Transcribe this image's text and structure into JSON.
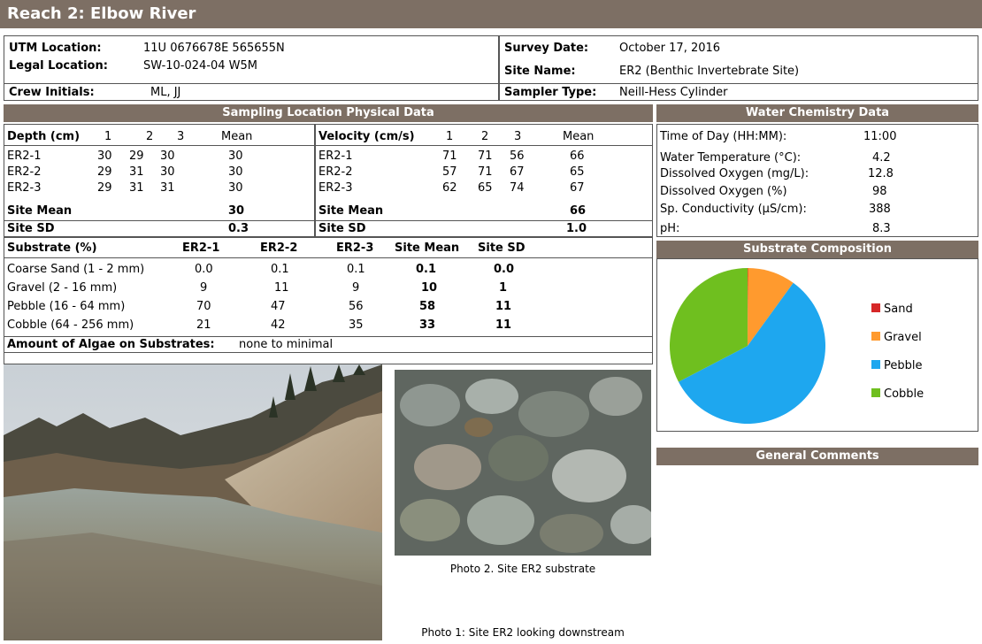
{
  "title": "Reach 2: Elbow River",
  "site": {
    "utm_label": "UTM Location:",
    "utm_value": "11U  0676678E  565655N",
    "legal_label": "Legal Location:",
    "legal_value": "SW-10-024-04 W5M",
    "crew_label": "Crew Initials:",
    "crew_value": "ML, JJ",
    "survey_label": "Survey Date:",
    "survey_value": "October 17, 2016",
    "sitename_label": "Site Name:",
    "sitename_value": "ER2  (Benthic Invertebrate Site)",
    "sampler_label": "Sampler Type:",
    "sampler_value": "Neill-Hess Cylinder"
  },
  "physical": {
    "header": "Sampling Location Physical Data",
    "depth": {
      "title": "Depth (cm)",
      "cols": [
        "1",
        "2",
        "3",
        "Mean"
      ],
      "rows": [
        {
          "name": "ER2-1",
          "v": [
            "30",
            "29",
            "30",
            "30"
          ]
        },
        {
          "name": "ER2-2",
          "v": [
            "29",
            "31",
            "30",
            "30"
          ]
        },
        {
          "name": "ER2-3",
          "v": [
            "29",
            "31",
            "31",
            "30"
          ]
        }
      ],
      "site_mean_label": "Site Mean",
      "site_mean": "30",
      "site_sd_label": "Site SD",
      "site_sd": "0.3"
    },
    "velocity": {
      "title": "Velocity (cm/s)",
      "cols": [
        "1",
        "2",
        "3",
        "Mean"
      ],
      "rows": [
        {
          "name": "ER2-1",
          "v": [
            "71",
            "71",
            "56",
            "66"
          ]
        },
        {
          "name": "ER2-2",
          "v": [
            "57",
            "71",
            "67",
            "65"
          ]
        },
        {
          "name": "ER2-3",
          "v": [
            "62",
            "65",
            "74",
            "67"
          ]
        }
      ],
      "site_mean_label": "Site Mean",
      "site_mean": "66",
      "site_sd_label": "Site SD",
      "site_sd": "1.0"
    }
  },
  "substrate": {
    "cols": [
      "Substrate (%)",
      "ER2-1",
      "ER2-2",
      "ER2-3",
      "Site Mean",
      "Site SD"
    ],
    "rows": [
      [
        "Coarse Sand (1 - 2 mm)",
        "0.0",
        "0.1",
        "0.1",
        "0.1",
        "0.0"
      ],
      [
        "Gravel (2 - 16 mm)",
        "9",
        "11",
        "9",
        "10",
        "1"
      ],
      [
        "Pebble (16 - 64 mm)",
        "70",
        "47",
        "56",
        "58",
        "11"
      ],
      [
        "Cobble (64 - 256 mm)",
        "21",
        "42",
        "35",
        "33",
        "11"
      ]
    ],
    "algae_label": "Amount of Algae on Substrates:",
    "algae_value": "none to minimal"
  },
  "water": {
    "header": "Water Chemistry Data",
    "rows": [
      {
        "label": "Time of Day (HH:MM):",
        "value": "11:00"
      },
      {
        "label": "Water Temperature (°C):",
        "value": "4.2"
      },
      {
        "label": "Dissolved Oxygen (mg/L):",
        "value": "12.8"
      },
      {
        "label": "Dissolved Oxygen (%)",
        "value": "98"
      },
      {
        "label": "Sp. Conductivity (µS/cm):",
        "value": "388"
      },
      {
        "label": "pH:",
        "value": "8.3"
      }
    ]
  },
  "composition_header": "Substrate Composition",
  "comments_header": "General Comments",
  "photo1_caption": "Photo 1: Site ER2 looking downstream",
  "photo2_caption": "Photo 2. Site ER2 substrate",
  "chart_data": {
    "type": "pie",
    "categories": [
      "Sand",
      "Gravel",
      "Pebble",
      "Cobble"
    ],
    "values": [
      0.1,
      10,
      58,
      33
    ],
    "colors": [
      "#d62728",
      "#ff9a2e",
      "#1ea7ef",
      "#6fbf1f"
    ],
    "legend_position": "right"
  }
}
